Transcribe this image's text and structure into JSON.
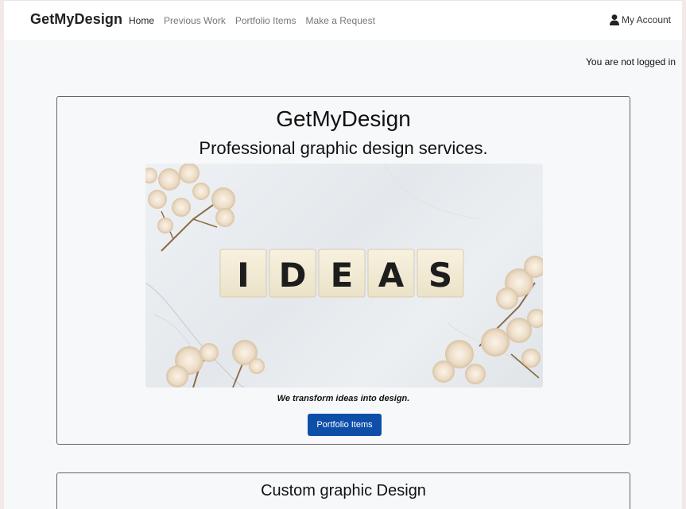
{
  "navbar": {
    "brand": "GetMyDesign",
    "links": [
      {
        "label": "Home",
        "active": true
      },
      {
        "label": "Previous Work",
        "active": false
      },
      {
        "label": "Portfolio Items",
        "active": false
      },
      {
        "label": "Make a Request",
        "active": false
      }
    ],
    "account_label": "My Account",
    "account_icon": "user-icon"
  },
  "login_status": "You are not logged in",
  "hero": {
    "title": "GetMyDesign",
    "subtitle": "Professional graphic design services.",
    "image_tiles": [
      "I",
      "D",
      "E",
      "A",
      "S"
    ],
    "caption": "We transform ideas into design.",
    "button_label": "Portfolio Items",
    "button_color": "#0d4fa8"
  },
  "services": {
    "title": "Custom graphic Design"
  }
}
